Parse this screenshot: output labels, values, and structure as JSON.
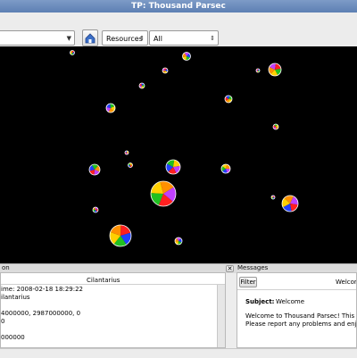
{
  "window": {
    "title": "TP: Thousand Parsec"
  },
  "toolbar": {
    "object_select": "",
    "overlay_select": "Resources",
    "filter_select": "All"
  },
  "star_icons": [
    "star-pie-icon"
  ],
  "info": {
    "title": "on",
    "name": "Cilantarius",
    "lines": [
      "ime: 2008-02-18 18:29:22",
      "ilantarius",
      "",
      "4000000, 2987000000, 0",
      "0",
      "",
      "000000"
    ]
  },
  "messages": {
    "title": "Messages",
    "filter_label": "Filter",
    "header": "Welcom",
    "subject_label": "Subject:",
    "subject": "Welcome",
    "body_line1": "Welcome to Thousand Parsec! This se",
    "body_line2": "Please report any problems and enjo"
  },
  "colors": {
    "pie": [
      "#ff2020",
      "#2040ff",
      "#20c020",
      "#ffd000",
      "#ff9000",
      "#c040ff"
    ]
  }
}
